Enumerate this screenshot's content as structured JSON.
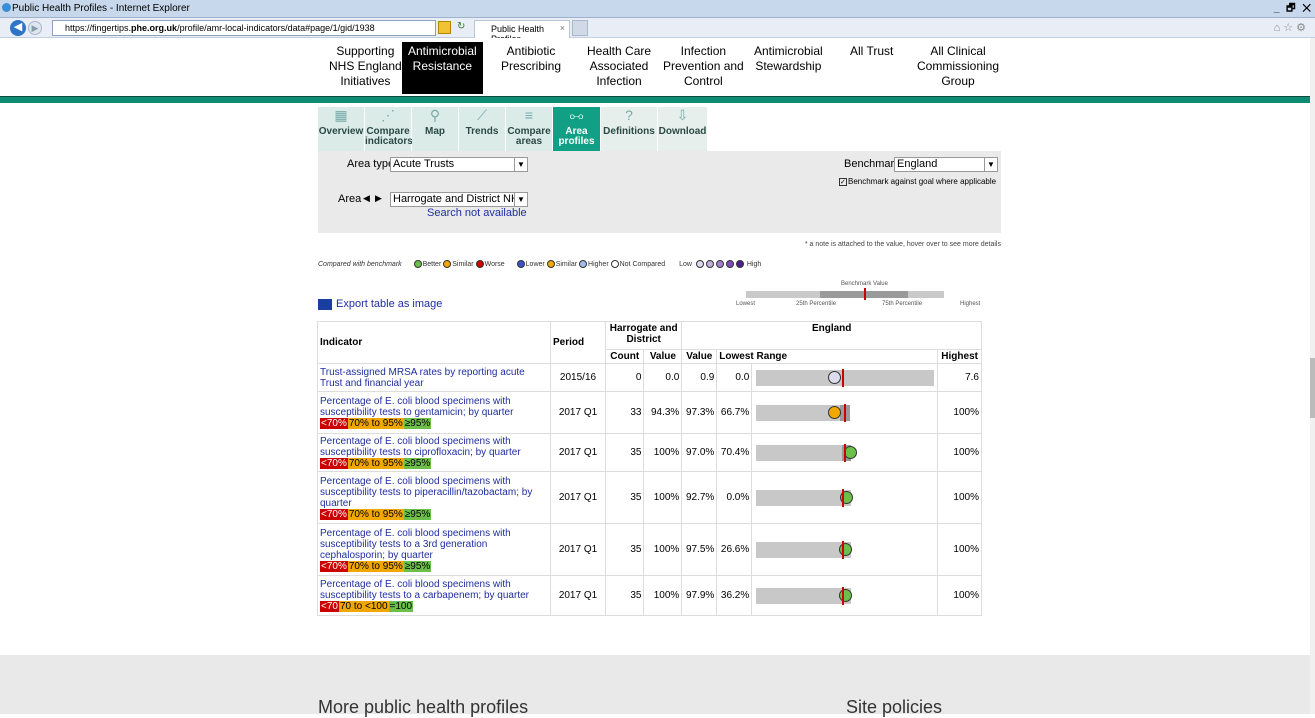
{
  "browser": {
    "title": "Public Health Profiles - Internet Explorer",
    "url_prefix": "https://fingertips.",
    "url_domain": "phe.org.uk",
    "url_path": "/profile/amr-local-indicators/data#page/1/gid/1938",
    "tab_label": "Public Health Profiles",
    "tab_close": "×",
    "window_controls": "_ 🗗 ✕"
  },
  "topnav": [
    {
      "label": "Supporting\nNHS England\nInitiatives"
    },
    {
      "label": "Antimicrobial\nResistance"
    },
    {
      "label": "Antibiotic\nPrescribing"
    },
    {
      "label": "Health Care\nAssociated\nInfection"
    },
    {
      "label": "Infection\nPrevention and\nControl"
    },
    {
      "label": "Antimicrobial\nStewardship"
    },
    {
      "label": "All Trust"
    },
    {
      "label": "All Clinical\nCommissioning\nGroup"
    }
  ],
  "tools": [
    {
      "label": "Overview",
      "glyph": "▦"
    },
    {
      "label": "Compare\nindicators",
      "glyph": "⋰"
    },
    {
      "label": "Map",
      "glyph": "⚲"
    },
    {
      "label": "Trends",
      "glyph": "⟋"
    },
    {
      "label": "Compare\nareas",
      "glyph": "≡"
    },
    {
      "label": "Area\nprofiles",
      "glyph": "⧟"
    },
    {
      "label": "Definitions",
      "glyph": "?"
    },
    {
      "label": "Download",
      "glyph": "⇩"
    }
  ],
  "filters": {
    "area_type_label": "Area type",
    "area_type_value": "Acute Trusts",
    "area_label": "Area",
    "area_value": "Harrogate and District NHS",
    "search_note": "Search not available",
    "benchmark_label": "Benchmark",
    "benchmark_value": "England",
    "benchmark_goal": "Benchmark against goal where applicable"
  },
  "note": "* a note is attached to the value, hover over to see more details",
  "legend": {
    "compared": "Compared with benchmark",
    "better": "Better",
    "similar": "Similar",
    "worse": "Worse",
    "lower": "Lower",
    "similar2": "Similar",
    "higher": "Higher",
    "not_compared": "Not Compared",
    "low": "Low",
    "high": "High"
  },
  "bench_legend": {
    "value": "Benchmark Value",
    "lowest": "Lowest",
    "p25": "25th Percentile",
    "p75": "75th Percentile",
    "highest": "Highest"
  },
  "export_label": "Export table as image",
  "table": {
    "h_indicator": "Indicator",
    "h_period": "Period",
    "h_area": "Harrogate and\nDistrict",
    "h_england": "England",
    "h_count": "Count",
    "h_value": "Value",
    "h_evalue": "Value",
    "h_lowest": "Lowest",
    "h_range": "Range",
    "h_highest": "Highest",
    "rows": [
      {
        "indicator": "Trust-assigned MRSA rates by reporting acute Trust and financial year",
        "badges": [],
        "period": "2015/16",
        "count": "0",
        "value": "0.0",
        "evalue": "0.9",
        "lowest": "0.0",
        "highest": "7.6"
      },
      {
        "indicator": "Percentage of E. coli blood specimens with susceptibility tests to gentamicin; by quarter",
        "badges": [
          "<70%",
          "70% to 95%",
          "≥95%"
        ],
        "period": "2017 Q1",
        "count": "33",
        "value": "94.3%",
        "evalue": "97.3%",
        "lowest": "66.7%",
        "highest": "100%"
      },
      {
        "indicator": "Percentage of E. coli blood specimens with susceptibility tests to ciprofloxacin; by quarter",
        "badges": [
          "<70%",
          "70% to 95%",
          "≥95%"
        ],
        "period": "2017 Q1",
        "count": "35",
        "value": "100%",
        "evalue": "97.0%",
        "lowest": "70.4%",
        "highest": "100%"
      },
      {
        "indicator": "Percentage of E. coli blood specimens with susceptibility tests to piperacillin/tazobactam; by quarter",
        "badges": [
          "<70%",
          "70% to 95%",
          "≥95%"
        ],
        "period": "2017 Q1",
        "count": "35",
        "value": "100%",
        "evalue": "92.7%",
        "lowest": "0.0%",
        "highest": "100%"
      },
      {
        "indicator": "Percentage of E. coli blood specimens with susceptibility tests to a 3rd generation cephalosporin; by quarter",
        "badges": [
          "<70%",
          "70% to 95%",
          "≥95%"
        ],
        "period": "2017 Q1",
        "count": "35",
        "value": "100%",
        "evalue": "97.5%",
        "lowest": "26.6%",
        "highest": "100%"
      },
      {
        "indicator": "Percentage of E. coli blood specimens with susceptibility tests to a carbapenem; by quarter",
        "badges": [
          "<70",
          "70 to <100",
          "=100"
        ],
        "period": "2017 Q1",
        "count": "35",
        "value": "100%",
        "evalue": "97.9%",
        "lowest": "36.2%",
        "highest": "100%"
      }
    ]
  },
  "footer": {
    "left": "More public health profiles",
    "right": "Site policies"
  }
}
